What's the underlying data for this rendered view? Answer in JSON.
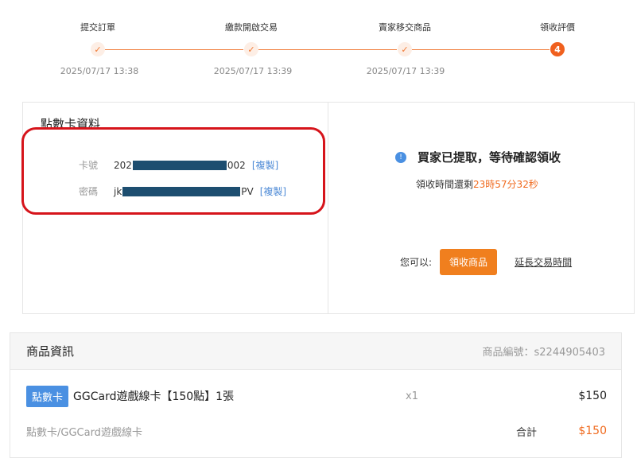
{
  "steps": [
    {
      "label": "提交訂單",
      "time": "2025/07/17 13:38",
      "status": "done",
      "icon": "check-icon"
    },
    {
      "label": "繳款開啟交易",
      "time": "2025/07/17 13:39",
      "status": "done",
      "icon": "check-icon"
    },
    {
      "label": "賣家移交商品",
      "time": "2025/07/17 13:39",
      "status": "done",
      "icon": "check-icon"
    },
    {
      "label": "領收評價",
      "time": "",
      "status": "current",
      "number": "4"
    }
  ],
  "card_info": {
    "title": "點數卡資料",
    "card_no_label": "卡號",
    "card_no_prefix": "202",
    "card_no_suffix": "002",
    "password_label": "密碼",
    "password_prefix": "jk",
    "password_suffix": "PV",
    "copy_label": "[複製]"
  },
  "status": {
    "info_icon": "info-icon",
    "message": "買家已提取，等待確認領收",
    "countdown_prefix": "領收時間還剩",
    "countdown_value": "23時57分32秒",
    "actions_prefix": "您可以:",
    "receive_button": "領收商品",
    "extend_link": "延長交易時間"
  },
  "product": {
    "header_title": "商品資訊",
    "product_code": "商品編號：s2244905403",
    "tag": "點數卡",
    "name": "GGCard遊戲線卡【150點】1張",
    "quantity": "x1",
    "price": "$150",
    "category": "點數卡/GGCard遊戲線卡",
    "total_label": "合計",
    "total_value": "$150"
  },
  "colors": {
    "accent": "#f07a35",
    "highlight_border": "#d6141b",
    "link": "#4d8ad6",
    "tag": "#4a90e2"
  }
}
